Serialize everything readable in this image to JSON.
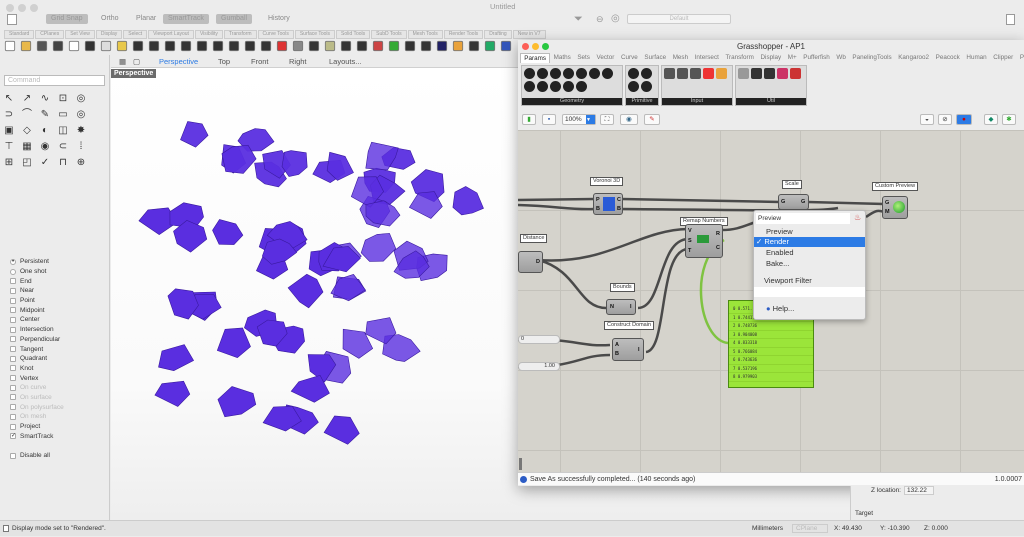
{
  "window": {
    "title": "Untitled"
  },
  "toggles": [
    {
      "label": "Grid Snap",
      "on": true
    },
    {
      "label": "Ortho",
      "on": false
    },
    {
      "label": "Planar",
      "on": false
    },
    {
      "label": "SmartTrack",
      "on": true
    },
    {
      "label": "Gumball",
      "on": true
    },
    {
      "label": "History",
      "on": false
    }
  ],
  "toolbar_tabs": [
    "Standard",
    "CPlanes",
    "Set View",
    "Display",
    "Select",
    "Viewport Layout",
    "Visibility",
    "Transform",
    "Curve Tools",
    "Surface Tools",
    "Solid Tools",
    "SubD Tools",
    "Mesh Tools",
    "Render Tools",
    "Drafting",
    "New in V7"
  ],
  "display_mode": "Default",
  "command": {
    "placeholder": "Command"
  },
  "viewport_tabs": [
    "Perspective",
    "Top",
    "Front",
    "Right",
    "Layouts..."
  ],
  "viewport_active": "Perspective",
  "viewport_label": "Perspective",
  "object_color": "#5a2ee0",
  "osnap": {
    "mode": [
      {
        "label": "Persistent",
        "checked": true
      },
      {
        "label": "One shot",
        "checked": false
      }
    ],
    "items": [
      {
        "label": "End",
        "checked": false,
        "enabled": true
      },
      {
        "label": "Near",
        "checked": false,
        "enabled": true
      },
      {
        "label": "Point",
        "checked": false,
        "enabled": true
      },
      {
        "label": "Midpoint",
        "checked": false,
        "enabled": true
      },
      {
        "label": "Center",
        "checked": false,
        "enabled": true
      },
      {
        "label": "Intersection",
        "checked": false,
        "enabled": true
      },
      {
        "label": "Perpendicular",
        "checked": false,
        "enabled": true
      },
      {
        "label": "Tangent",
        "checked": false,
        "enabled": true
      },
      {
        "label": "Quadrant",
        "checked": false,
        "enabled": true
      },
      {
        "label": "Knot",
        "checked": false,
        "enabled": true
      },
      {
        "label": "Vertex",
        "checked": false,
        "enabled": true
      },
      {
        "label": "On curve",
        "checked": false,
        "enabled": false
      },
      {
        "label": "On surface",
        "checked": false,
        "enabled": false
      },
      {
        "label": "On polysurface",
        "checked": false,
        "enabled": false
      },
      {
        "label": "On mesh",
        "checked": false,
        "enabled": false
      },
      {
        "label": "Project",
        "checked": false,
        "enabled": true
      },
      {
        "label": "SmartTrack",
        "checked": true,
        "enabled": true
      }
    ],
    "disable_all": "Disable all"
  },
  "grasshopper": {
    "title": "Grasshopper - AP1",
    "tabs": [
      "Params",
      "Maths",
      "Sets",
      "Vector",
      "Curve",
      "Surface",
      "Mesh",
      "Intersect",
      "Transform",
      "Display",
      "M+",
      "Pufferfish",
      "Wb",
      "PanelingTools",
      "Kangaroo2",
      "Peacock",
      "Human",
      "Clipper",
      "Para"
    ],
    "active_tab": "Params",
    "groups": [
      "Geometry",
      "Primitive",
      "Input",
      "Util"
    ],
    "zoom": "100%",
    "nodes": {
      "voronoi": {
        "label": "Voronoi 3D",
        "inputs": [
          "P",
          "B"
        ],
        "outputs": [
          "C",
          "B"
        ]
      },
      "scale": {
        "label": "Scale",
        "inputs": [
          "G"
        ],
        "outputs": [
          "G"
        ]
      },
      "custom_preview": {
        "label": "Custom Preview",
        "inputs": [
          "G",
          "M"
        ]
      },
      "distance": {
        "label": "Distance",
        "outputs": [
          "D"
        ]
      },
      "remap": {
        "label": "Remap Numbers",
        "inputs": [
          "V",
          "S",
          "T"
        ],
        "outputs": [
          "R",
          "C"
        ]
      },
      "bounds": {
        "label": "Bounds",
        "inputs": [
          "N"
        ],
        "outputs": [
          "I"
        ]
      },
      "construct_domain": {
        "label": "Construct Domain",
        "inputs": [
          "A",
          "B"
        ],
        "outputs": [
          "I"
        ]
      },
      "slider_a": {
        "value": "0"
      },
      "slider_b": {
        "value": "1.00"
      }
    },
    "panel_values": [
      "0 0.571...",
      "1 0.744175",
      "2 0.748736",
      "3 0.904008",
      "4 0.833318",
      "5 0.766084",
      "6 0.743636",
      "7 0.537196",
      "8 0.979903"
    ],
    "context_menu": {
      "name_field": "Preview",
      "items": [
        {
          "label": "Preview",
          "checked": false
        },
        {
          "label": "Render",
          "checked": true
        },
        {
          "label": "Enabled",
          "checked": false
        },
        {
          "label": "Bake...",
          "checked": false
        },
        {
          "label": "Viewport Filter",
          "checked": false
        },
        {
          "label": "Help...",
          "checked": false
        }
      ]
    },
    "status": "Save As successfully completed... (140 seconds ago)",
    "version": "1.0.0007"
  },
  "properties": {
    "z_location_label": "Z location:",
    "z_location": "132.22",
    "target_label": "Target"
  },
  "statusbar": {
    "message": "Display mode set to \"Rendered\".",
    "units": "Millimeters",
    "cplane": "CPlane",
    "x": "X: 49.430",
    "y": "Y: -10.390",
    "z": "Z: 0.000"
  }
}
